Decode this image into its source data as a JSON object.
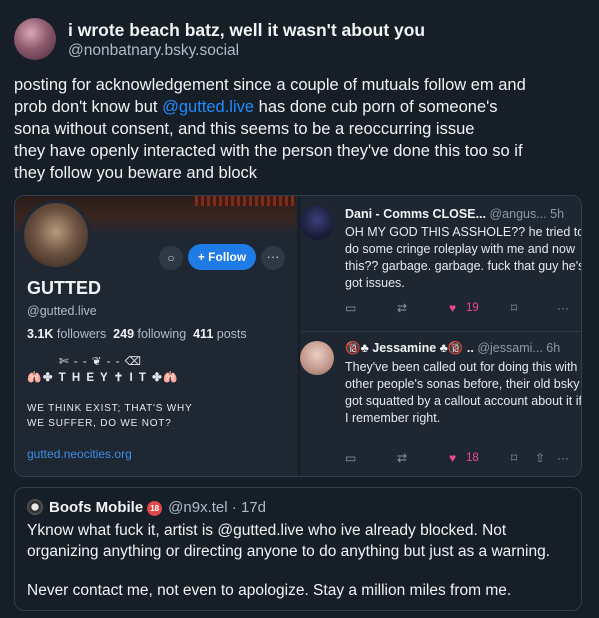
{
  "post": {
    "display_name": "i wrote beach batz, well it wasn't about you",
    "handle": "@nonbatnary.bsky.social",
    "text_lines": [
      "posting for acknowledgement since a couple of mutuals follow em and",
      "prob don't know but ",
      "@gutted.live",
      " has done cub porn of someone's",
      "sona without consent, and this seems to be a reoccurring issue",
      "they have openly interacted with the person they've done this too so if",
      "they follow you beware and block"
    ]
  },
  "profile_card": {
    "name": "GUTTED",
    "handle": "@gutted.live",
    "followers_count": "3.1K",
    "followers_label": "followers",
    "following_count": "249",
    "following_label": "following",
    "posts_count": "411",
    "posts_label": "posts",
    "follow_label": "Follow",
    "follow_plus": "+",
    "bio_line1": "✄ - - ❦ - - ⌫",
    "bio_line2": "🫁✤ T H E Y ✝ I T ✤🫁",
    "bio_line3": "WE THINK EXIST; THAT'S WHY",
    "bio_line4": "WE SUFFER, DO WE NOT?",
    "link": "gutted.neocities.org"
  },
  "replies": [
    {
      "name": "Dani - Comms CLOSE...",
      "handle": "@angus...",
      "time": "5h",
      "text": "OH MY GOD THIS ASSHOLE?? he tried to do some cringe roleplay with me and now this?? garbage. garbage. fuck that guy he's got issues.",
      "likes": "19"
    },
    {
      "name": "🔞♣ Jessamine ♣🔞 ..",
      "handle": "@jessami...",
      "time": "6h",
      "text": "They've been called out for doing this with other people's sonas before, their old bsky got squatted by a callout account about it if I remember right.",
      "likes": "18"
    }
  ],
  "quote": {
    "name": "Boofs Mobile",
    "badge": "18",
    "handle": "@n9x.tel",
    "time": "17d",
    "line1": "Yknow what fuck it, artist is @gutted.live who ive already blocked. Not",
    "line2": "organizing anything or directing anyone to do anything but just as a warning.",
    "line3": "Never contact me, not even to apologize. Stay a million miles from me."
  },
  "icons": {
    "reply": "💬",
    "repost": "⇄",
    "like": "♥",
    "bookmark": "⌑",
    "share": "⇧",
    "more": "···"
  },
  "colors": {
    "background": "#161e27",
    "accent": "#208bfe",
    "like": "#ec4899"
  }
}
